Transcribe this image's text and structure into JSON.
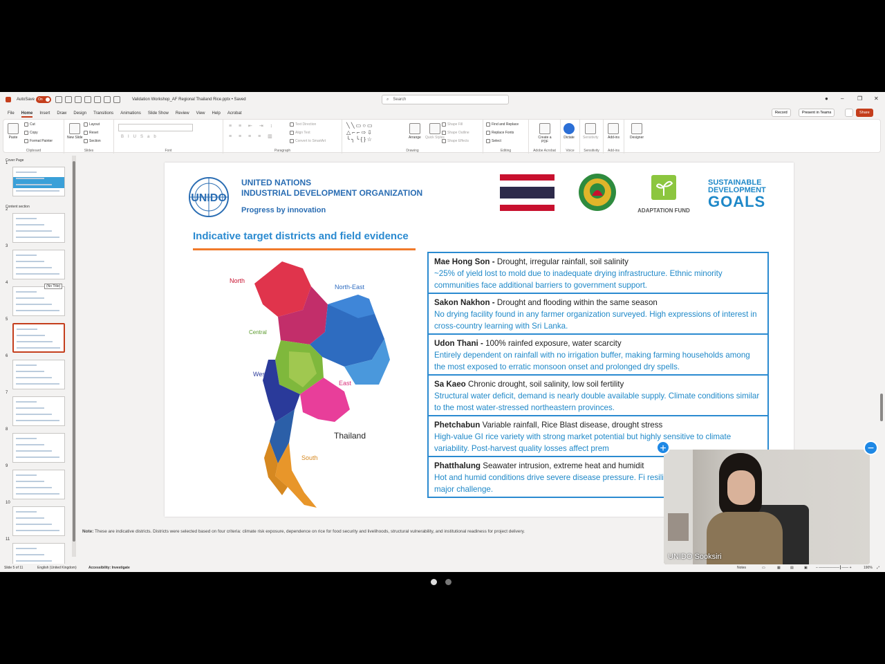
{
  "titlebar": {
    "autosave_label": "AutoSave",
    "autosave_state": "On",
    "file_title": "Validation Workshop_AF Regional Thailand Rice.pptx • Saved",
    "search_placeholder": "Search"
  },
  "menu_tabs": [
    "File",
    "Home",
    "Insert",
    "Draw",
    "Design",
    "Transitions",
    "Animations",
    "Slide Show",
    "Review",
    "View",
    "Help",
    "Acrobat"
  ],
  "active_tab": "Home",
  "menu_right": {
    "record": "Record",
    "present_in_teams": "Present in Teams",
    "share": "Share"
  },
  "ribbon": {
    "clipboard": {
      "paste": "Paste",
      "cut": "Cut",
      "copy": "Copy",
      "format_painter": "Format Painter",
      "label": "Clipboard"
    },
    "slides": {
      "new_slide": "New Slide",
      "layout": "Layout",
      "reset": "Reset",
      "section": "Section",
      "label": "Slides"
    },
    "font": {
      "label": "Font"
    },
    "paragraph": {
      "text_direction": "Text Direction",
      "align_text": "Align Text",
      "convert_smartart": "Convert to SmartArt",
      "label": "Paragraph"
    },
    "drawing": {
      "arrange": "Arrange",
      "quick_styles": "Quick Styles",
      "shape_fill": "Shape Fill",
      "shape_outline": "Shape Outline",
      "shape_effects": "Shape Effects",
      "label": "Drawing"
    },
    "editing": {
      "find_replace": "Find and Replace",
      "replace_fonts": "Replace Fonts",
      "select": "Select",
      "label": "Editing"
    },
    "adobe": {
      "create_pdf": "Create a PDF",
      "label": "Adobe Acrobat"
    },
    "voice": {
      "dictate": "Dictate",
      "label": "Voice"
    },
    "sensitivity": {
      "button": "Sensitivity",
      "label": "Sensitivity"
    },
    "addins": {
      "button": "Add-ins",
      "label": "Add-ins"
    },
    "designer": {
      "button": "Designer"
    }
  },
  "thumbnails": {
    "section_cover": "Cover Page",
    "section_content": "Content section",
    "numbers": [
      "1",
      "2",
      "3",
      "4",
      "5",
      "6",
      "7",
      "8",
      "9",
      "10",
      "11"
    ],
    "tooltip": "(No Title)"
  },
  "slide": {
    "org_line1": "UNITED NATIONS",
    "org_line2": "INDUSTRIAL DEVELOPMENT ORGANIZATION",
    "org_tagline": "Progress by innovation",
    "unido_logo_text": "UNIDO",
    "adaptation_fund": "ADAPTATION FUND",
    "sdg_line1": "SUSTAINABLE",
    "sdg_line2": "DEVELOPMENT",
    "sdg_line3": "GOALS",
    "title": "Indicative target districts and field evidence",
    "map_labels": {
      "north": "North",
      "north_east": "North-East",
      "central": "Central",
      "west": "West",
      "east": "East",
      "south": "South",
      "country": "Thailand"
    },
    "evidence": [
      {
        "name": "Mae Hong Son -",
        "risk": " Drought, irregular rainfall, soil salinity",
        "body": " ~25% of yield lost to mold due to inadequate drying infrastructure. Ethnic minority communities face additional barriers to government support."
      },
      {
        "name": "Sakon Nakhon -",
        "risk": " Drought and flooding within the same season",
        "body": "No drying facility found in any farmer organization surveyed. High expressions of interest in cross-country learning with Sri Lanka."
      },
      {
        "name": "Udon Thani -",
        "risk": " 100% rainfed exposure, water scarcity",
        "body": "Entirely dependent on rainfall with no irrigation buffer, making farming households among the most exposed to erratic monsoon onset and prolonged dry spells."
      },
      {
        "name": "Sa Kaeo",
        "risk": " Chronic drought, soil salinity, low soil fertility",
        "body": "Structural water deficit, demand is nearly double available supply. Climate conditions similar to the most water-stressed northeastern provinces."
      },
      {
        "name": "Phetchabun",
        "risk": " Variable rainfall, Rice Blast disease, drought stress",
        "body": "High-value GI rice variety with strong market potential but highly sensitive to climate variability. Post-harvest quality losses affect prem"
      },
      {
        "name": "Phatthalung",
        "risk": " Seawater intrusion, extreme heat and humidit",
        "body": "Hot and humid conditions drive severe disease pressure. Fi resilient varieties remains a major challenge."
      }
    ],
    "note_label": "Note:",
    "note_text": " These are indicative districts. Districts were selected based on four criteria: climate risk exposure, dependence on rice for food security and livelihoods, structural vulnerability, and institutional readiness for project delivery."
  },
  "video": {
    "participant_name": "UNIDO Sooksiri",
    "plus": "+",
    "minus": "−"
  },
  "statusbar": {
    "slide_info": "Slide 5 of 11",
    "language": "English (United Kingdom)",
    "accessibility": "Accessibility: Investigate",
    "notes": "Notes",
    "zoom": "190%"
  },
  "colors": {
    "accent": "#c43e1c",
    "slide_blue": "#2a8ad0",
    "rule_orange": "#f07a2a"
  }
}
